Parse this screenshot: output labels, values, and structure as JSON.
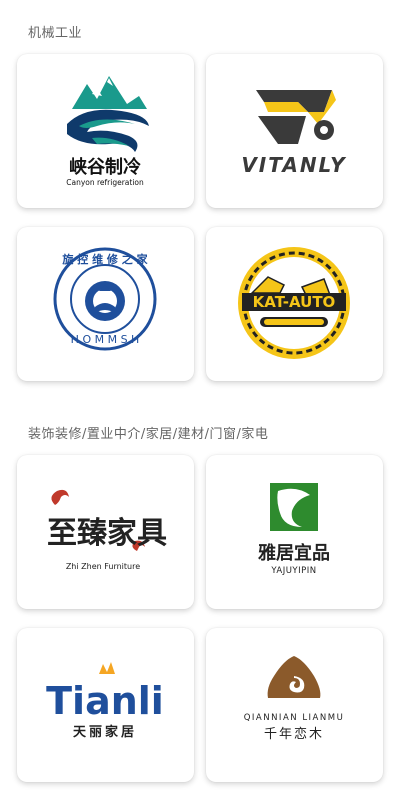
{
  "sections": [
    {
      "title": "机械工业"
    },
    {
      "title": "装饰装修/置业中介/家居/建材/门窗/家电"
    }
  ],
  "logos": {
    "xiagu": {
      "cn": "峡谷制冷",
      "en": "Canyon refrigeration"
    },
    "vitanly": {
      "text": "VITANLY"
    },
    "hommsh": {
      "top_text": "旋 控 维 修 之 家",
      "bottom_text": "H O M M S H"
    },
    "katauto": {
      "text": "KAT-AUTO"
    },
    "zhizhen": {
      "cn": "至臻家具",
      "en": "Zhi Zhen Furniture"
    },
    "yaju": {
      "cn": "雅居宜品",
      "en": "YAJUYIPIN"
    },
    "tianli": {
      "en": "Tianli",
      "cn": "天丽家居"
    },
    "qiannian": {
      "en": "QIANNIAN LIANMU",
      "cn": "千年恋木"
    }
  },
  "colors": {
    "teal": "#1a9a8c",
    "navy": "#0f3a6b",
    "yellow": "#f5c518",
    "dark": "#222222",
    "red": "#c0392b",
    "green": "#2e8b2e",
    "brown": "#8b5a2b",
    "blue": "#1f4f9c",
    "orange": "#f5a623"
  }
}
